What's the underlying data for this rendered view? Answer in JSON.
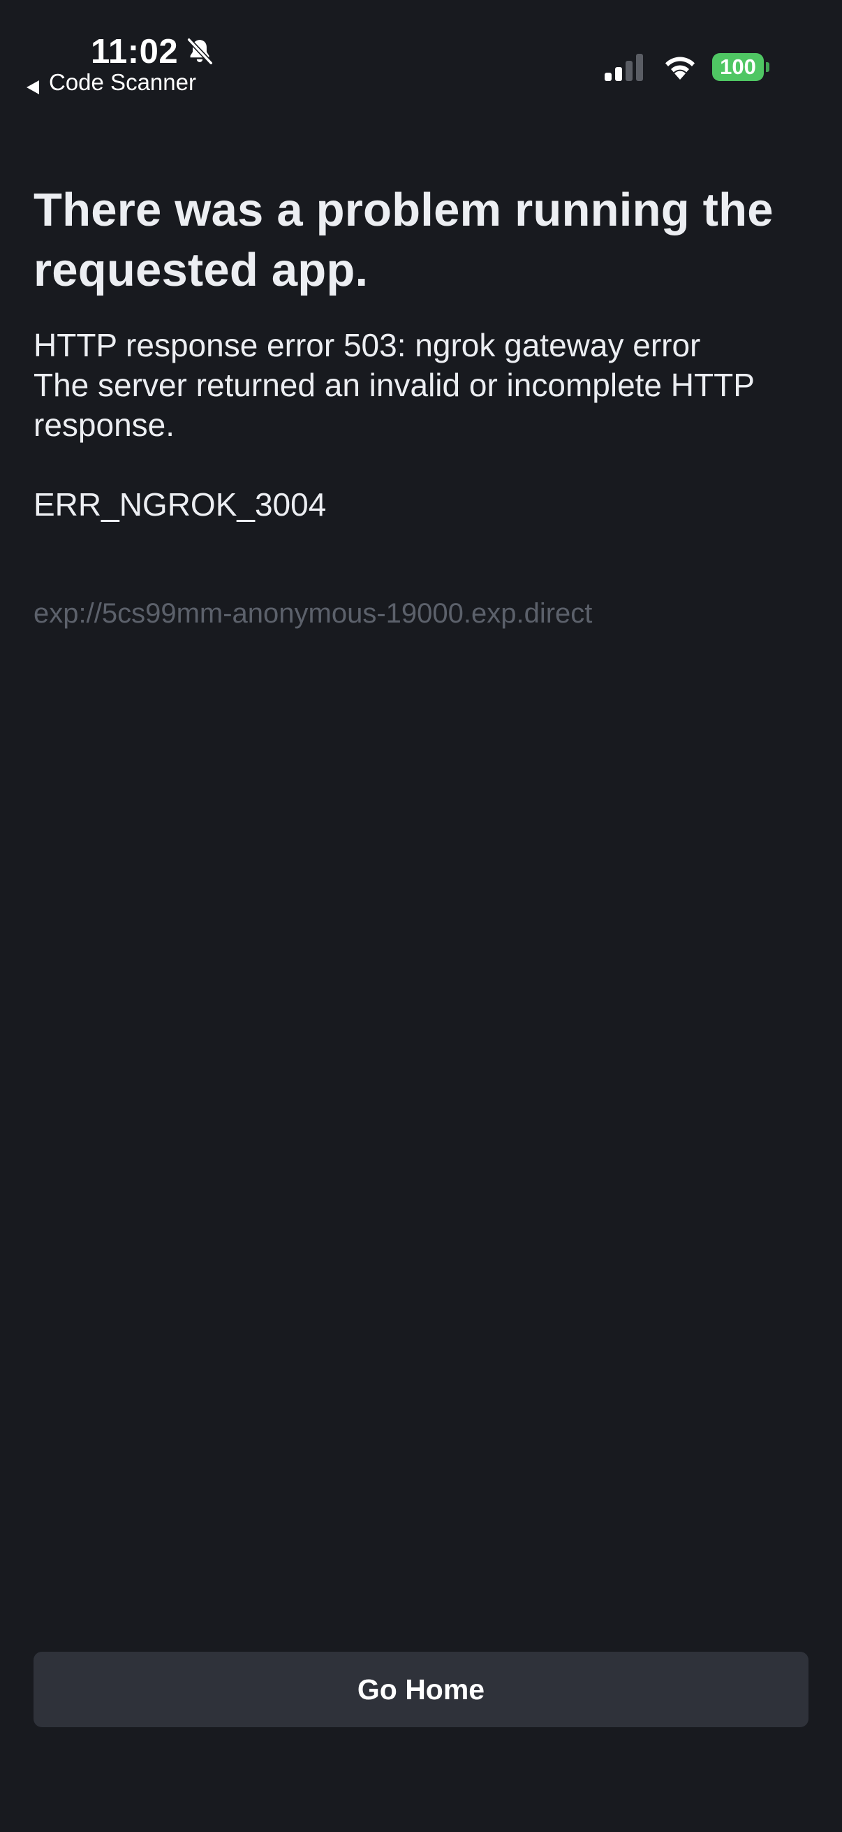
{
  "status_bar": {
    "time": "11:02",
    "back_label": "Code Scanner",
    "battery_level": "100",
    "signal_bars_active": 2,
    "signal_bars_total": 4,
    "icons": {
      "bell": "bell-slash-icon",
      "back": "back-arrow-icon",
      "signal": "cellular-signal-icon",
      "wifi": "wifi-icon",
      "battery": "battery-icon"
    }
  },
  "error": {
    "title": "There was a problem running the requested app.",
    "message": "HTTP response error 503: ngrok gateway error\nThe server returned an invalid or incomplete HTTP response.",
    "code": "ERR_NGROK_3004",
    "url": "exp://5cs99mm-anonymous-19000.exp.direct"
  },
  "actions": {
    "go_home_label": "Go Home"
  },
  "colors": {
    "background": "#181a1f",
    "text_primary": "#eceef2",
    "text_muted": "#5c616b",
    "button_bg": "#2f323a",
    "battery_green": "#4fc663"
  }
}
